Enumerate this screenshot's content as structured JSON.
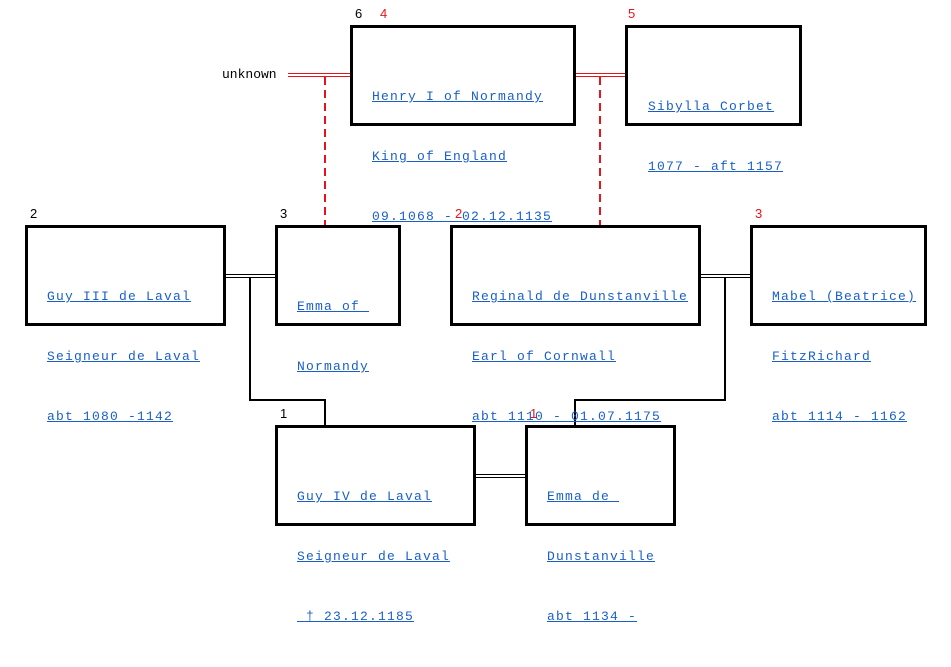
{
  "colors": {
    "link": "#1a5fc8",
    "red": "#e8141c",
    "line": "#000000"
  },
  "unknown_label": "unknown",
  "persons": [
    {
      "id": "henry",
      "number": "6",
      "number2": "4",
      "lines": [
        "Henry I of Normandy",
        "King of England",
        "09.1068 - 02.12.1135"
      ]
    },
    {
      "id": "sibylla",
      "number": "5",
      "lines": [
        "Sibylla Corbet",
        "1077 - aft 1157"
      ]
    },
    {
      "id": "guy3",
      "number": "2",
      "lines": [
        "Guy III de Laval",
        "Seigneur de Laval",
        "abt 1080 -1142"
      ]
    },
    {
      "id": "emma-normandy",
      "number": "3",
      "lines": [
        "Emma of ",
        "Normandy"
      ]
    },
    {
      "id": "reginald",
      "number": "2",
      "lines": [
        "Reginald de Dunstanville",
        "Earl of Cornwall",
        "abt 1110 - 01.07.1175"
      ]
    },
    {
      "id": "mabel",
      "number": "3",
      "lines": [
        "Mabel (Beatrice)",
        "FitzRichard",
        "abt 1114 - 1162"
      ]
    },
    {
      "id": "guy4",
      "number": "1",
      "lines": [
        "Guy IV de Laval",
        "Seigneur de Laval",
        " † 23.12.1185"
      ]
    },
    {
      "id": "emma-dunstanville",
      "number": "1",
      "lines": [
        "Emma de ",
        "Dunstanville",
        "abt 1134 -"
      ]
    }
  ]
}
